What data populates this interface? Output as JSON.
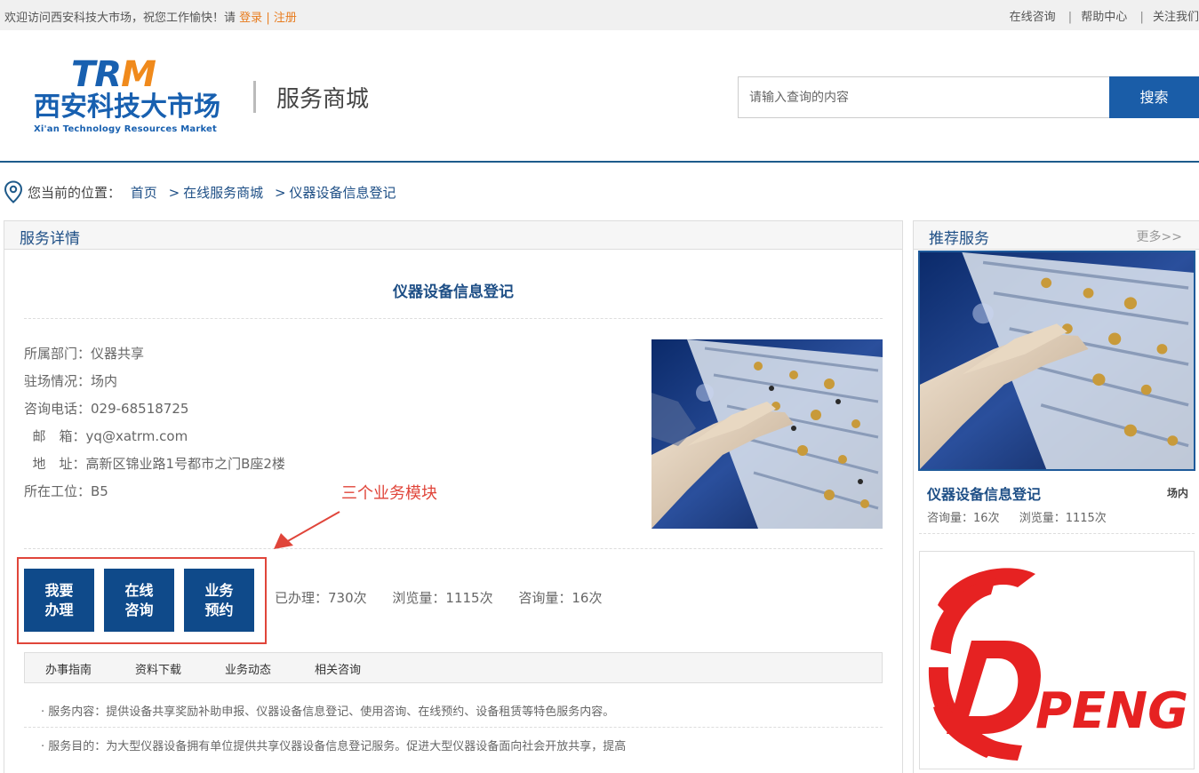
{
  "topbar": {
    "welcome_text": "欢迎访问西安科技大市场，祝您工作愉快！请",
    "login_label": "登录",
    "separator": "|",
    "register_label": "注册",
    "links": [
      "在线咨询",
      "帮助中心",
      "关注我们"
    ]
  },
  "header": {
    "logo": {
      "tr": "TR",
      "m": "M",
      "name_cn": "西安科技大市场",
      "name_en": "Xi'an Technology Resources Market"
    },
    "site_title": "服务商城",
    "search": {
      "placeholder": "请输入查询的内容",
      "button_label": "搜索"
    }
  },
  "breadcrumb": {
    "prefix": "您当前的位置：",
    "items": [
      "首页",
      "在线服务商城",
      "仪器设备信息登记"
    ],
    "separator": ">"
  },
  "main": {
    "panel_title": "服务详情",
    "service_title": "仪器设备信息登记",
    "info": [
      {
        "label": "所属部门：",
        "value": "仪器共享"
      },
      {
        "label": "驻场情况：",
        "value": "场内"
      },
      {
        "label": "咨询电话：",
        "value": "029-68518725"
      },
      {
        "label": "  邮　箱：",
        "value": "yq@xatrm.com"
      },
      {
        "label": "  地　址：",
        "value": "高新区锦业路1号都市之门B座2楼"
      },
      {
        "label": "所在工位：",
        "value": "B5"
      }
    ],
    "annotation": "三个业务模块",
    "action_buttons": [
      "我要\n办理",
      "在线\n咨询",
      "业务\n预约"
    ],
    "stats": [
      "已办理：730次",
      "浏览量：1115次",
      "咨询量：16次"
    ],
    "tabs": [
      "办事指南",
      "资料下载",
      "业务动态",
      "相关咨询"
    ],
    "descriptions": [
      "· 服务内容：提供设备共享奖励补助申报、仪器设备信息登记、使用咨询、在线预约、设备租赁等特色服务内容。",
      "· 服务目的：为大型仪器设备拥有单位提供共享仪器设备信息登记服务。促进大型仪器设备面向社会开放共享，提高"
    ]
  },
  "sidebar": {
    "title": "推荐服务",
    "more_label": "更多>>",
    "recommended": {
      "title": "仪器设备信息登记",
      "location": "场内",
      "consult_count": "咨询量：16次",
      "view_count": "浏览量：1115次"
    },
    "ad_text": "DPENG"
  },
  "colors": {
    "brand_blue": "#1a5da8",
    "accent_orange": "#f08a1c",
    "annotation_red": "#e0453a",
    "button_blue": "#0f4a8a"
  }
}
